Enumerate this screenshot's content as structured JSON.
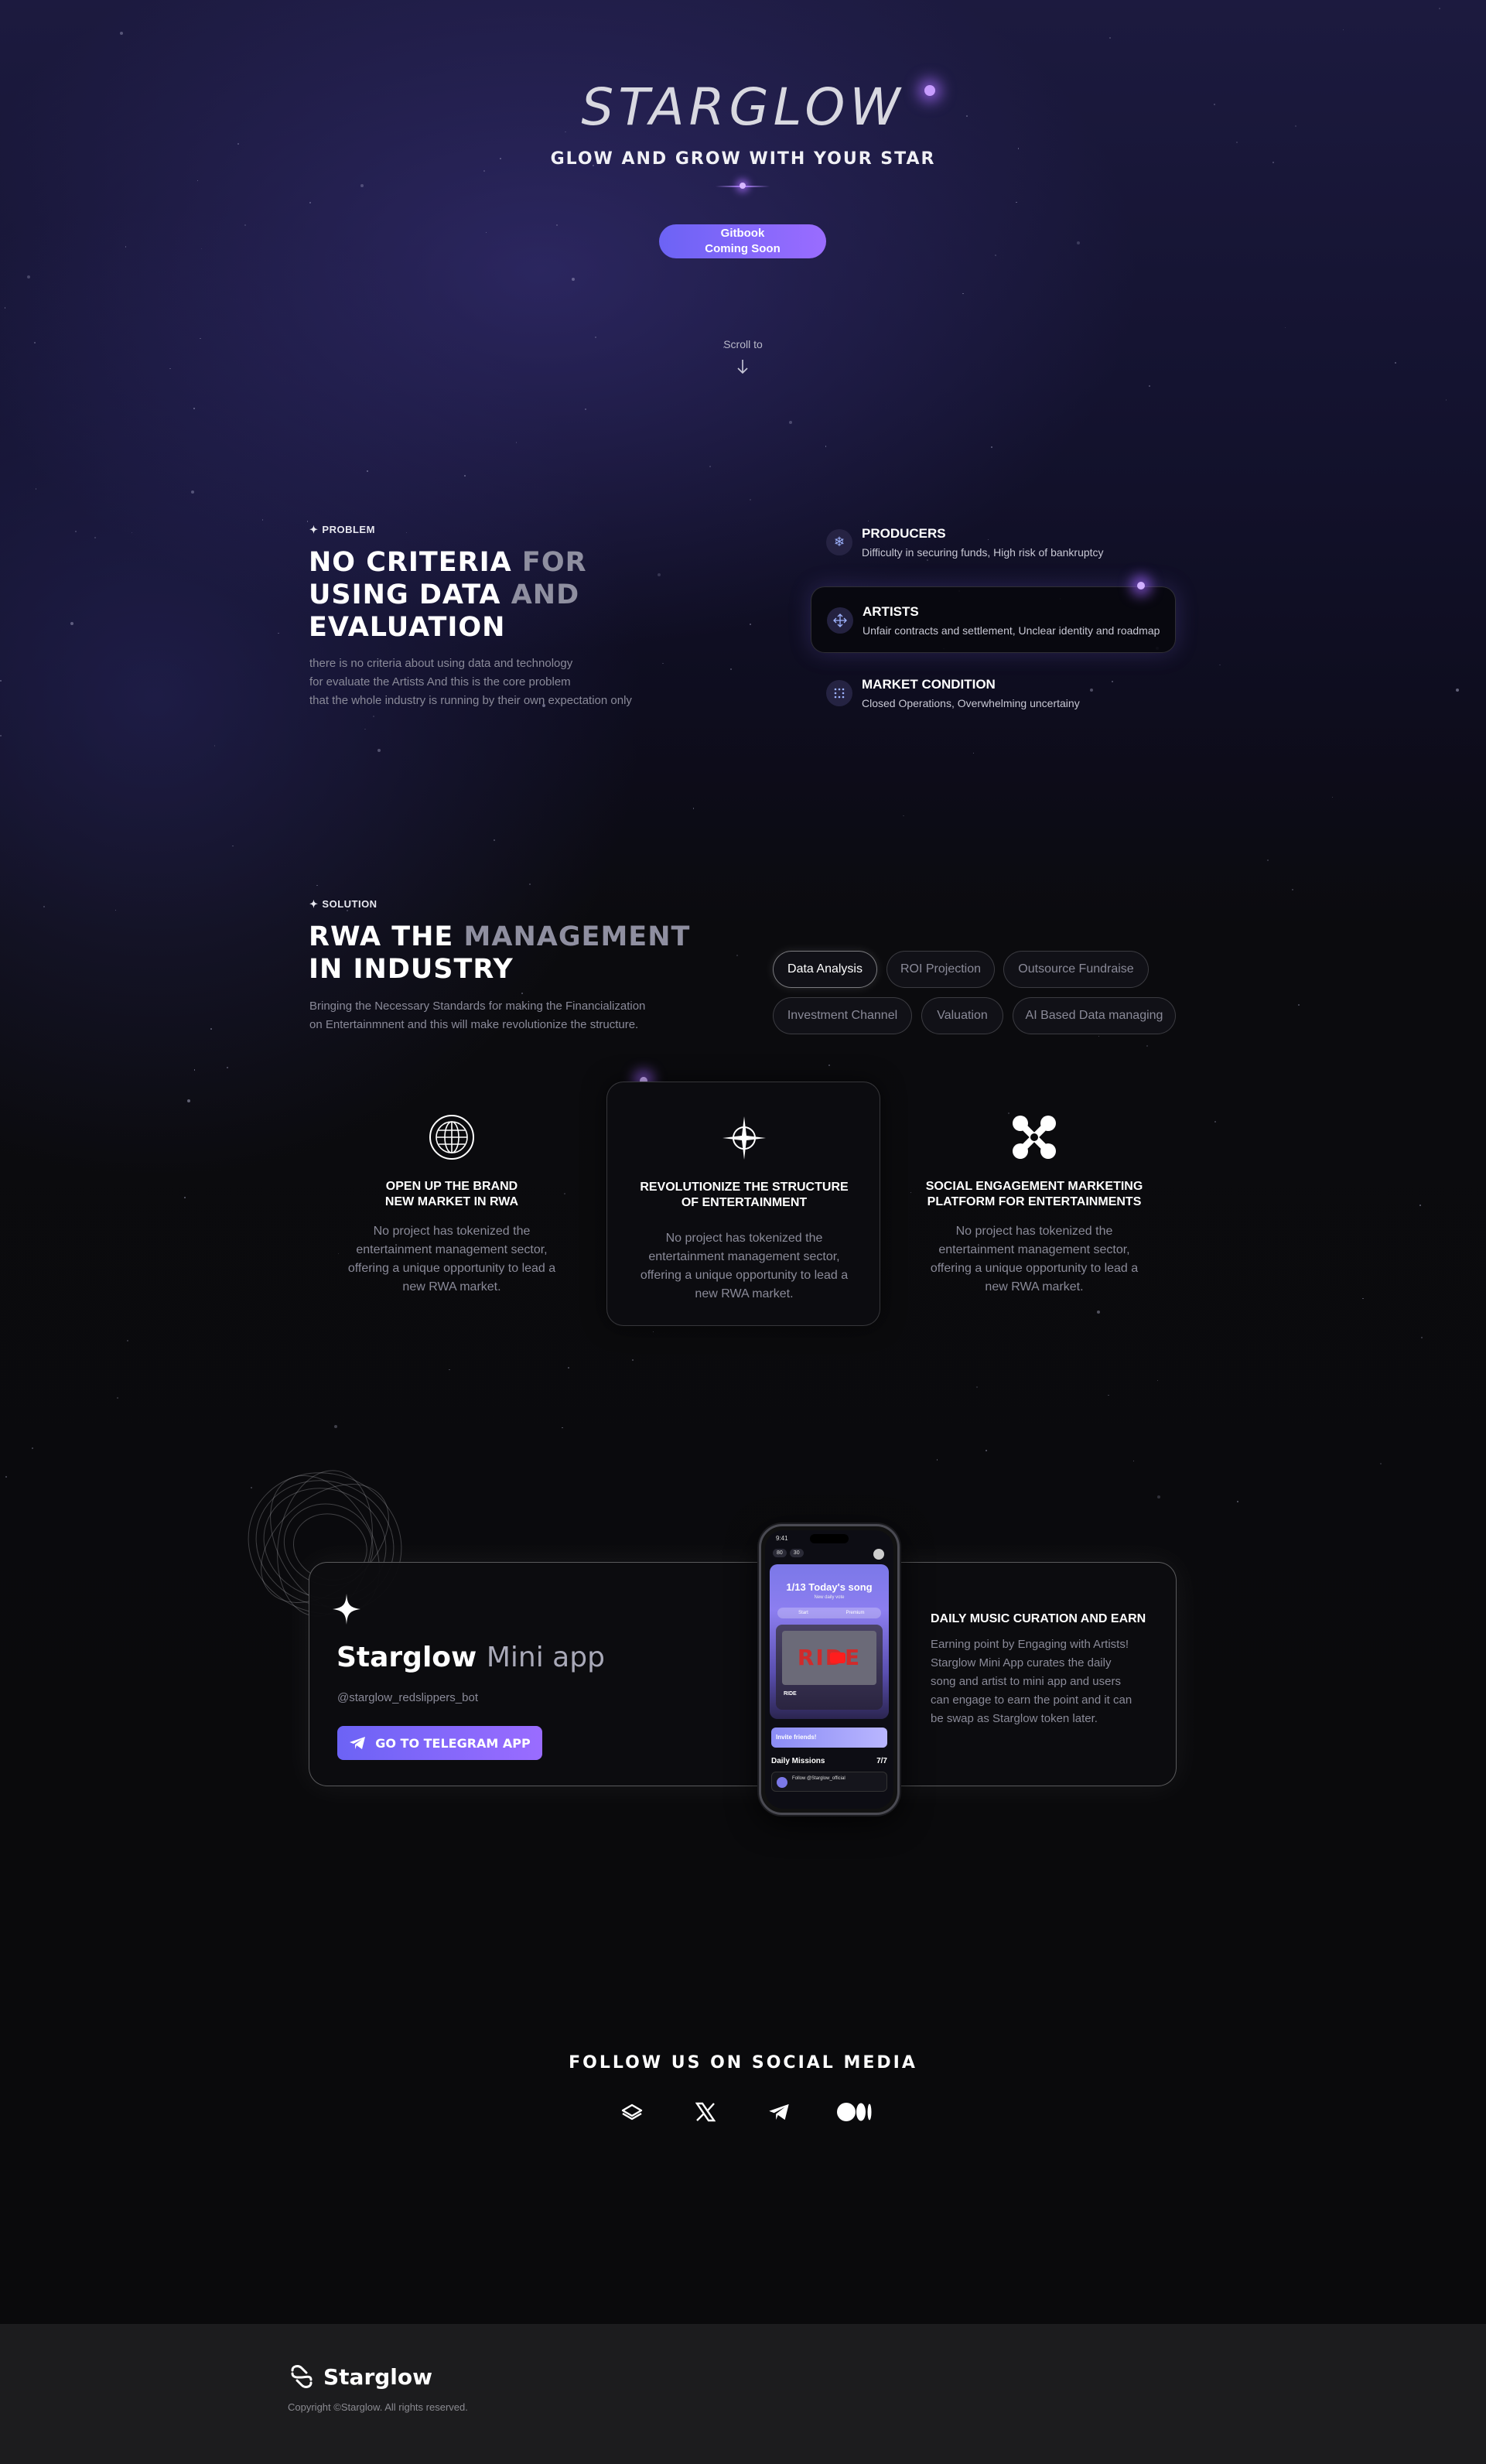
{
  "hero": {
    "brand": "STARGLOW",
    "tagline": "GLOW AND GROW WITH YOUR STAR",
    "gitbook_line1": "Gitbook",
    "gitbook_line2": "Coming Soon",
    "scroll_label": "Scroll to"
  },
  "problem": {
    "label": "PROBLEM",
    "title_line1_a": "NO CRITERIA ",
    "title_line1_b": "FOR",
    "title_line2_a": "USING DATA ",
    "title_line2_b": "AND",
    "title_line3": "EVALUATION",
    "desc_line1": "there is no criteria about using data and technology",
    "desc_line2": "for evaluate  the Artists And this is the core problem",
    "desc_line3": "that the whole industry is running by their own expectation only",
    "items": [
      {
        "title": "PRODUCERS",
        "desc": "Difficulty in securing funds, High risk of bankruptcy",
        "icon": "snowflake-icon"
      },
      {
        "title": "ARTISTS",
        "desc": "Unfair contracts and settlement, Unclear identity and roadmap",
        "icon": "move-icon"
      },
      {
        "title": "MARKET CONDITION",
        "desc": "Closed Operations, Overwhelming uncertainy",
        "icon": "dots-grid-icon"
      }
    ]
  },
  "solution": {
    "label": "SOLUTION",
    "title_line1_a": "RWA THE ",
    "title_line1_b": "MANAGEMENT",
    "title_line2": "IN INDUSTRY",
    "desc_line1": "Bringing the Necessary Standards for making the Financialization",
    "desc_line2": "on Entertainmnent and this will make revolutionize the structure.",
    "chips": [
      "Data Analysis",
      "ROI Projection",
      "Outsource Fundraise",
      "Investment Channel",
      "Valuation",
      "AI Based Data managing"
    ],
    "cards": [
      {
        "title_l1": "OPEN UP THE BRAND",
        "title_l2": "NEW MARKET IN RWA",
        "desc_l1": "No project has tokenized the",
        "desc_l2": "entertainment management sector,",
        "desc_l3": "offering a unique opportunity to lead a",
        "desc_l4": "new RWA market.",
        "icon": "globe-icon"
      },
      {
        "title_l1": "REVOLUTIONIZE THE STRUCTURE",
        "title_l2": "OF ENTERTAINMENT",
        "desc_l1": "No project has tokenized the",
        "desc_l2": "entertainment management sector,",
        "desc_l3": "offering a unique opportunity to lead a",
        "desc_l4": "new RWA market.",
        "icon": "compass-star-icon"
      },
      {
        "title_l1": "SOCIAL ENGAGEMENT MARKETING",
        "title_l2": "PLATFORM FOR ENTERTAINMENTS",
        "desc_l1": "No project has tokenized the",
        "desc_l2": "entertainment management sector,",
        "desc_l3": "offering a unique opportunity to lead a",
        "desc_l4": "new RWA market.",
        "icon": "network-icon"
      }
    ]
  },
  "mini_app": {
    "title_a": "Starglow ",
    "title_b": "Mini app",
    "handle": "@starglow_redslippers_bot",
    "button": "GO TO TELEGRAM APP",
    "right_title": "DAILY MUSIC CURATION AND EARN",
    "right_l1": "Earning point by Engaging with Artists!",
    "right_l2": "Starglow Mini App curates the daily",
    "right_l3": "song and artist to mini app and users",
    "right_l4": "can engage to earn the point and it can",
    "right_l5": "be swap as Starglow token later.",
    "phone": {
      "time": "9:41",
      "pill1": "80",
      "pill2": "30",
      "song_title": "1/13 Today's song",
      "song_sub": "New daily vote",
      "tab1": "Start",
      "tab2": "Premium",
      "video_title": "RIDE",
      "video_label": "RIDE",
      "invite": "Invite friends!",
      "missions": "Daily Missions",
      "missions_count": "7/7",
      "follow": "Follow @Starglow_official"
    }
  },
  "social": {
    "title": "FOLLOW US ON SOCIAL MEDIA",
    "icons": [
      "gitbook-icon",
      "x-icon",
      "telegram-icon",
      "medium-icon"
    ]
  },
  "footer": {
    "brand": "Starglow",
    "copyright": "Copyright ©Starglow. All rights reserved."
  },
  "colors": {
    "accent_start": "#6c63f5",
    "accent_end": "#9a6cff",
    "background": "#0a0a0c",
    "footer_bg": "#1c1c1e"
  }
}
